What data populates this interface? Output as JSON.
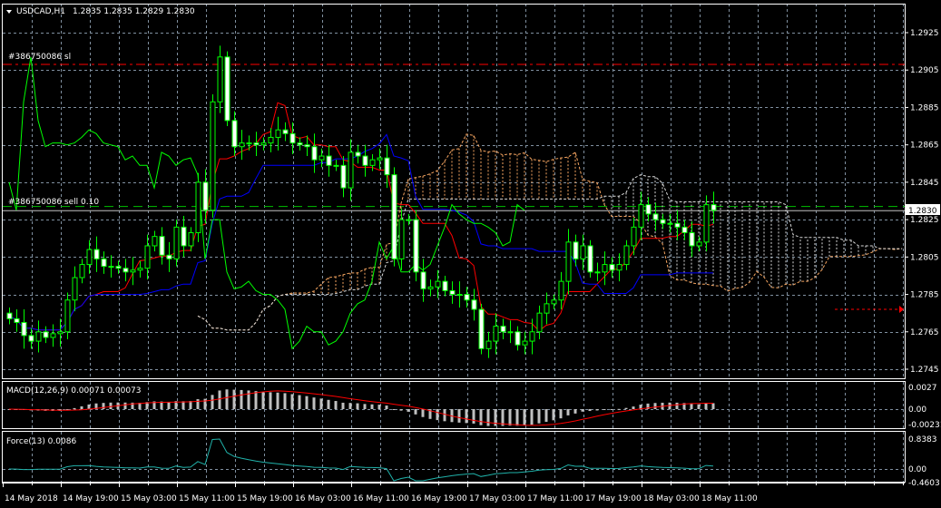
{
  "header": {
    "symbol": "USDCAD,H1",
    "ohlc": "1.2835 1.2835 1.2829 1.2830"
  },
  "orders": {
    "sl_label": "#386750086 sl",
    "sl_price": 1.2908,
    "sell_label": "#386750086 sell 0.10",
    "sell_price": 1.2832
  },
  "current_price": {
    "label": "1.2830",
    "value": 1.283
  },
  "alert_arrow_price": 1.2777,
  "price_axis": [
    "1.2925",
    "1.2905",
    "1.2885",
    "1.2865",
    "1.2845",
    "1.2825",
    "1.2805",
    "1.2785",
    "1.2765",
    "1.2745"
  ],
  "macd": {
    "label": "MACD(12,26,9) 0.00071 0.00073",
    "ticks": [
      "0.0027",
      "0.00",
      "-0.00231"
    ]
  },
  "force": {
    "label": "Force(13) 0.0086",
    "ticks": [
      "0.8383",
      "0.00",
      "-0.4603"
    ]
  },
  "time_axis": [
    "14 May 2018",
    "14 May 19:00",
    "15 May 03:00",
    "15 May 11:00",
    "15 May 19:00",
    "16 May 03:00",
    "16 May 11:00",
    "16 May 19:00",
    "17 May 03:00",
    "17 May 11:00",
    "17 May 19:00",
    "18 May 03:00",
    "18 May 11:00"
  ],
  "colors": {
    "bg": "#000000",
    "grid": "#8090a0",
    "candle": "#00ff00",
    "tenkan": "#ff0000",
    "kijun": "#0000ff",
    "chikou": "#00ff00",
    "spanA": "#f4a460",
    "spanB": "#d8d8d8",
    "macd_hist": "#c0c0c0",
    "macd_signal": "#ff0000",
    "force": "#20b2aa"
  },
  "chart_data": {
    "type": "candlestick",
    "title": "USDCAD,H1",
    "indicators": [
      "Ichimoku",
      "MACD(12,26,9)",
      "Force(13)"
    ],
    "ylim": [
      1.2745,
      1.2925
    ],
    "closes": [
      1.2772,
      1.277,
      1.2763,
      1.276,
      1.2765,
      1.2762,
      1.2764,
      1.2765,
      1.2782,
      1.2794,
      1.2801,
      1.2809,
      1.2804,
      1.28,
      1.28,
      1.2799,
      1.2797,
      1.2798,
      1.2799,
      1.2811,
      1.2816,
      1.2806,
      1.2804,
      1.2821,
      1.2811,
      1.2818,
      1.2845,
      1.283,
      1.2888,
      1.2912,
      1.2878,
      1.2864,
      1.2866,
      1.2866,
      1.2865,
      1.2866,
      1.2869,
      1.2873,
      1.2871,
      1.2866,
      1.2865,
      1.2864,
      1.2857,
      1.2859,
      1.2854,
      1.2854,
      1.2842,
      1.2861,
      1.2859,
      1.2854,
      1.2857,
      1.2858,
      1.2849,
      1.2804,
      1.2825,
      1.2825,
      1.2797,
      1.2788,
      1.2789,
      1.2792,
      1.2787,
      1.2785,
      1.2785,
      1.2782,
      1.2777,
      1.2756,
      1.276,
      1.2768,
      1.2765,
      1.2765,
      1.2758,
      1.276,
      1.2765,
      1.2775,
      1.278,
      1.2782,
      1.2792,
      1.2813,
      1.2804,
      1.2811,
      1.2797,
      1.2797,
      1.2801,
      1.2798,
      1.2801,
      1.2811,
      1.2821,
      1.2833,
      1.2828,
      1.2825,
      1.2823,
      1.2823,
      1.2821,
      1.2818,
      1.2811,
      1.2813,
      1.2833,
      1.283
    ]
  }
}
